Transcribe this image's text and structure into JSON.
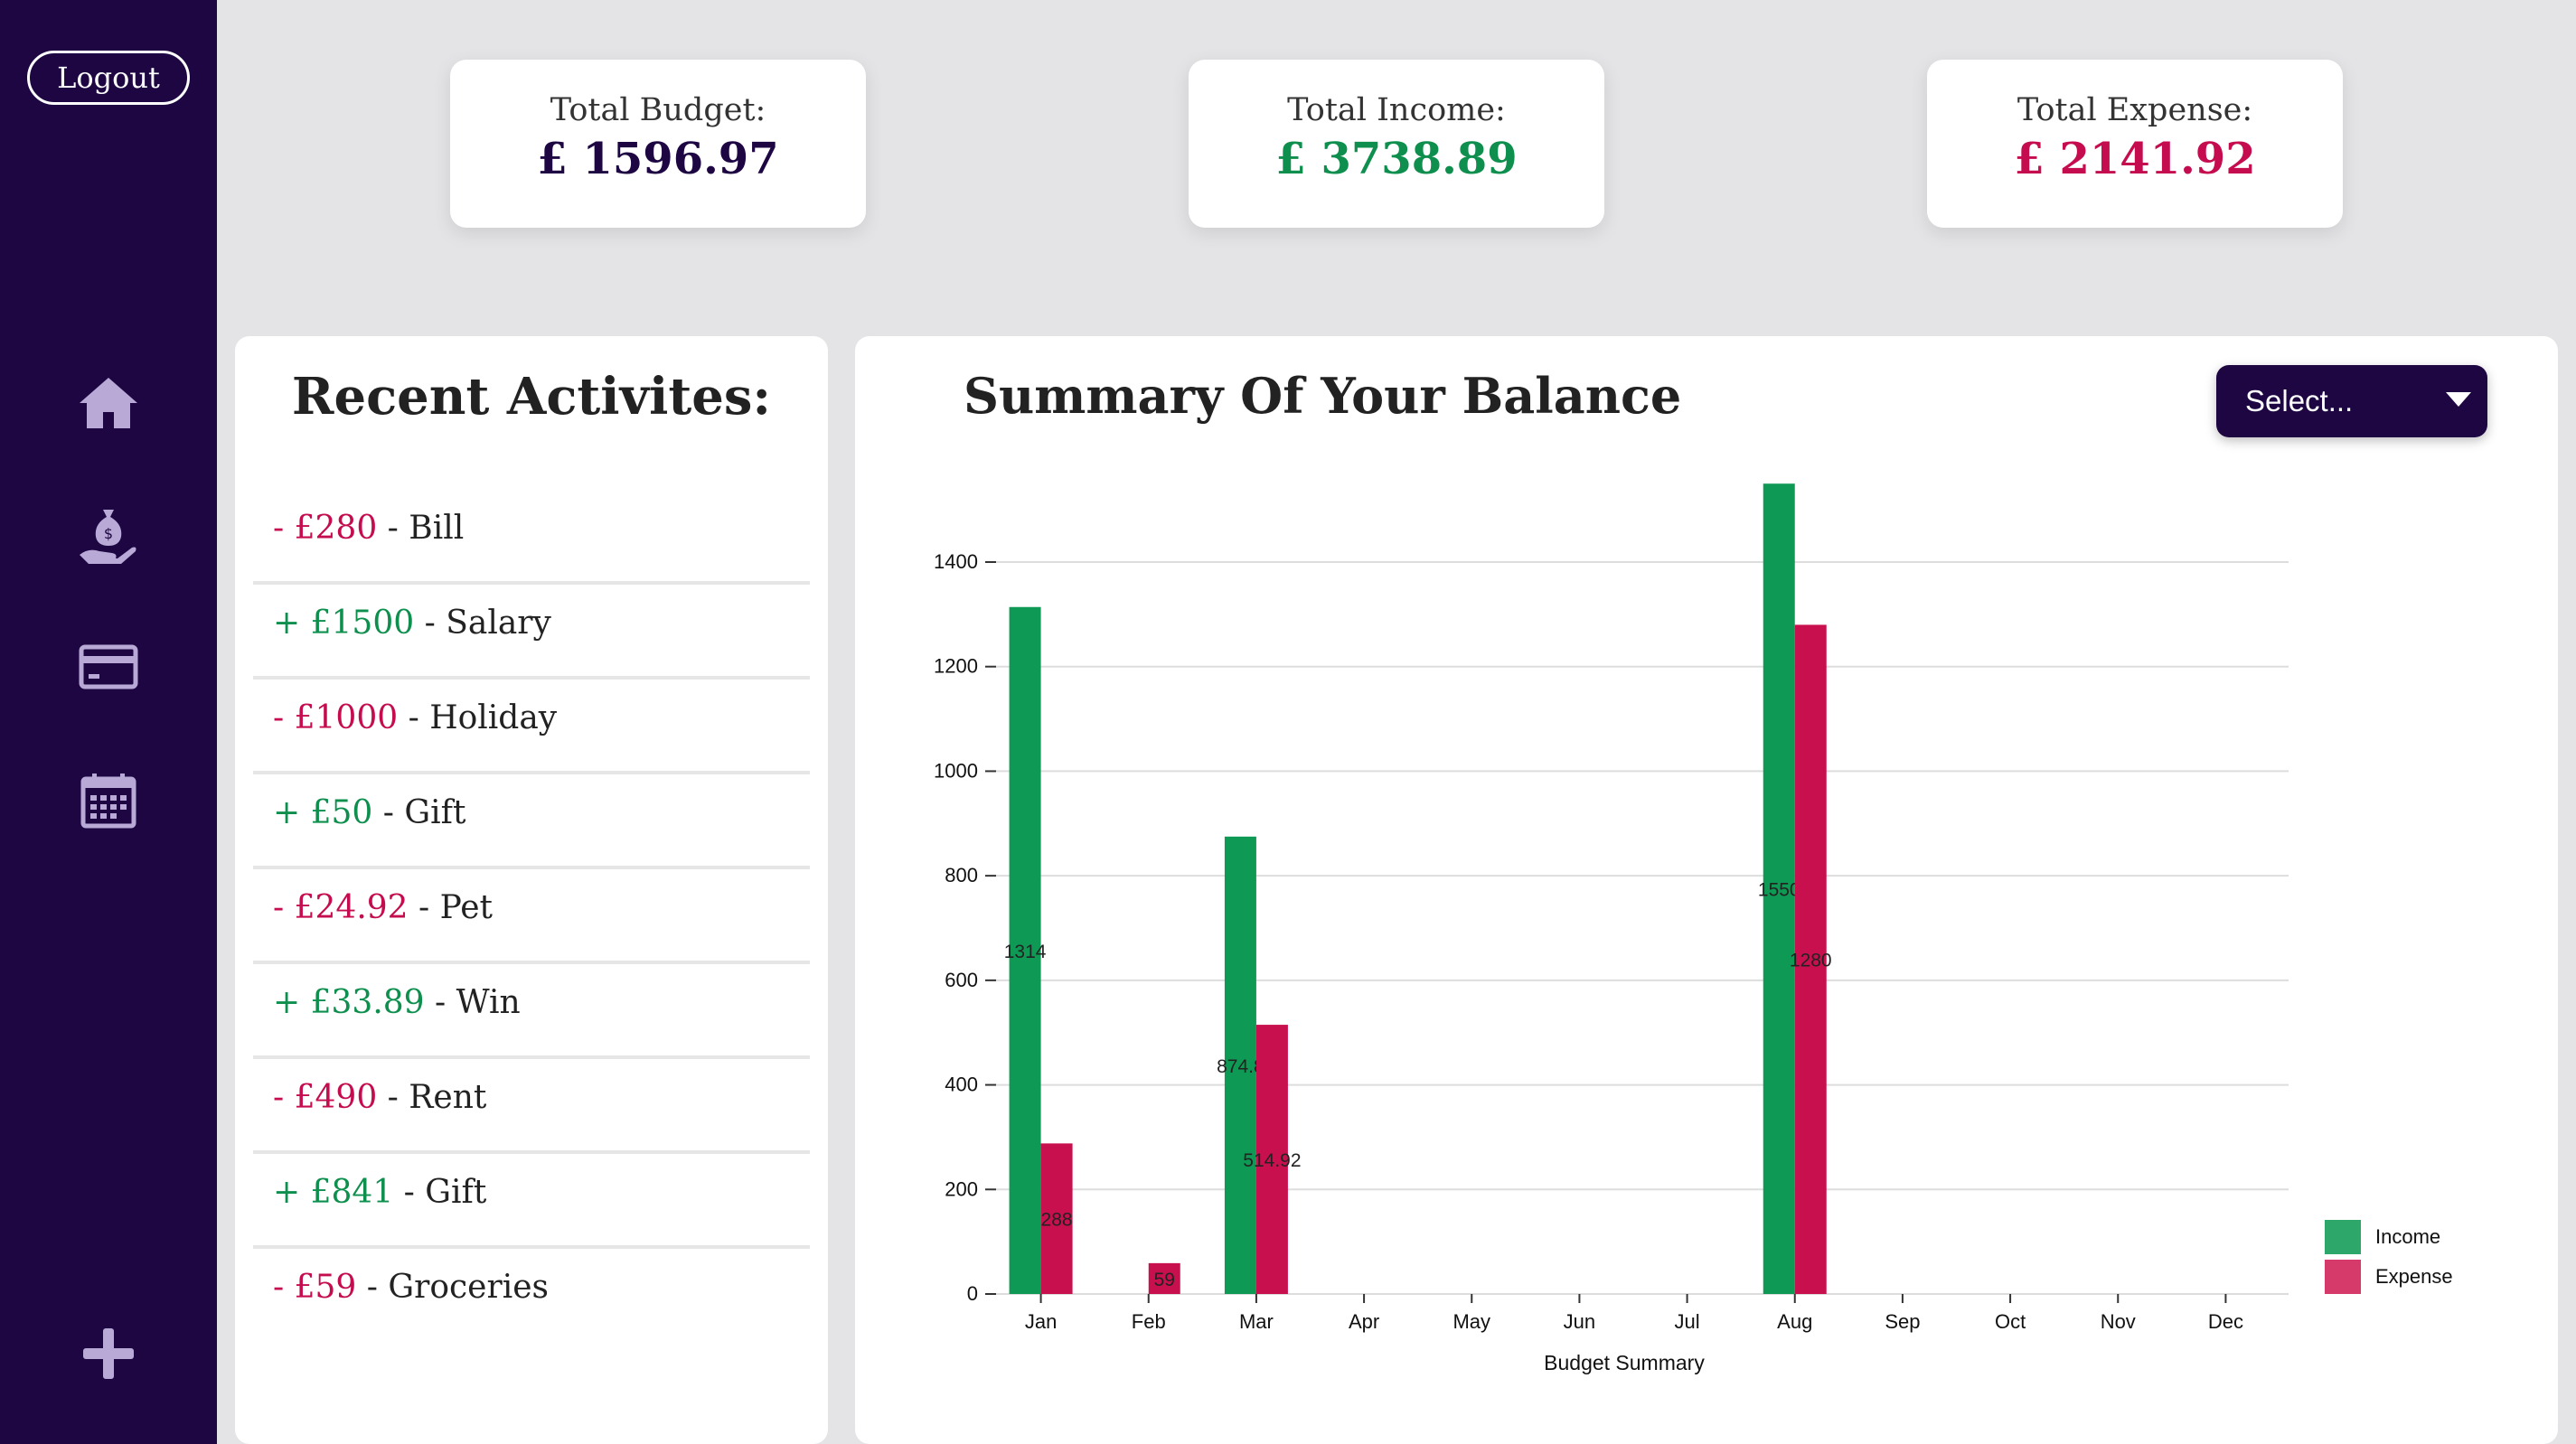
{
  "sidebar": {
    "logout_label": "Logout",
    "icons": [
      "home-icon",
      "money-bag-hand-icon",
      "credit-card-icon",
      "calendar-icon",
      "plus-icon"
    ]
  },
  "stats": {
    "budget": {
      "label": "Total Budget:",
      "value": "£ 1596.97",
      "color": "#1d0642"
    },
    "income": {
      "label": "Total Income:",
      "value": "£ 3738.89",
      "color": "#0e8f4e"
    },
    "expense": {
      "label": "Total Expense:",
      "value": "£ 2141.92",
      "color": "#c40c4e"
    }
  },
  "activities": {
    "title": "Recent Activites:",
    "items": [
      {
        "amount": "- £280",
        "desc": " - Bill",
        "type": "neg"
      },
      {
        "amount": "+ £1500",
        "desc": " - Salary",
        "type": "pos"
      },
      {
        "amount": "- £1000",
        "desc": " - Holiday",
        "type": "neg"
      },
      {
        "amount": "+ £50",
        "desc": " - Gift",
        "type": "pos"
      },
      {
        "amount": "- £24.92",
        "desc": " - Pet",
        "type": "neg"
      },
      {
        "amount": "+ £33.89",
        "desc": " - Win",
        "type": "pos"
      },
      {
        "amount": "- £490",
        "desc": " - Rent",
        "type": "neg"
      },
      {
        "amount": "+ £841",
        "desc": " - Gift",
        "type": "pos"
      },
      {
        "amount": "- £59",
        "desc": " - Groceries",
        "type": "neg"
      }
    ]
  },
  "summary": {
    "title": "Summary Of Your Balance",
    "select_label": "Select..."
  },
  "colors": {
    "sidebar": "#1d0642",
    "income": "#0e9a54",
    "expense": "#c8104f",
    "income_legend": "#2ea86a",
    "expense_legend": "#d63a6a"
  },
  "chart_data": {
    "type": "bar",
    "categories": [
      "Jan",
      "Feb",
      "Mar",
      "Apr",
      "May",
      "Jun",
      "Jul",
      "Aug",
      "Sep",
      "Oct",
      "Nov",
      "Dec"
    ],
    "series": [
      {
        "name": "Income",
        "values": [
          1314,
          0,
          874.89,
          0,
          0,
          0,
          0,
          1550,
          0,
          0,
          0,
          0
        ],
        "labels": [
          "1314",
          "",
          "874.8",
          "",
          "",
          "",
          "",
          "1550",
          "",
          "",
          "",
          ""
        ]
      },
      {
        "name": "Expense",
        "values": [
          288,
          59,
          514.92,
          0,
          0,
          0,
          0,
          1280,
          0,
          0,
          0,
          0
        ],
        "labels": [
          "288",
          "59",
          "514.92",
          "",
          "",
          "",
          "",
          "1280",
          "",
          "",
          "",
          ""
        ]
      }
    ],
    "xlabel": "Budget Summary",
    "ylabel": "",
    "ylim": [
      0,
      1400
    ],
    "yticks": [
      0,
      200,
      400,
      600,
      800,
      1000,
      1200,
      1400
    ],
    "grid": true,
    "legend": "bottom-right"
  }
}
